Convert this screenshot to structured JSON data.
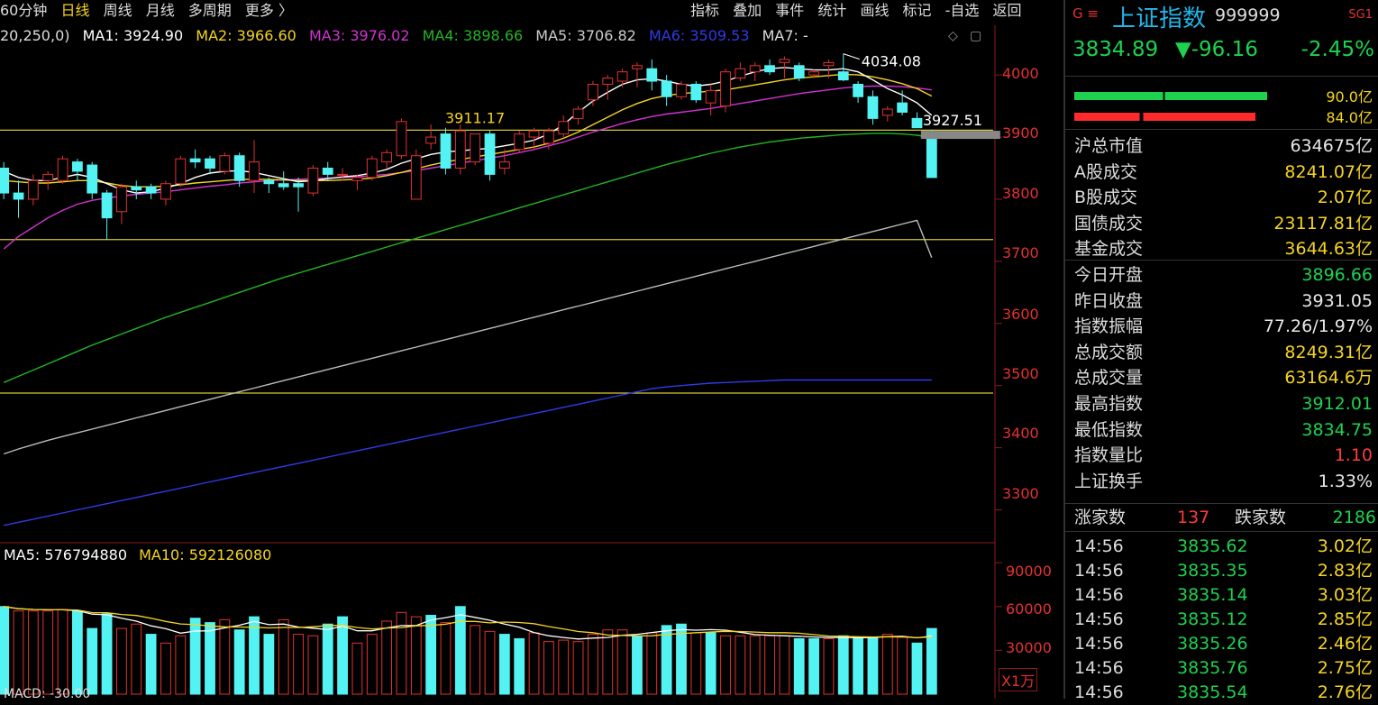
{
  "toolbar": {
    "left": [
      "60分钟",
      "日线",
      "周线",
      "月线",
      "多周期",
      "更多 〉"
    ],
    "right": [
      "指标",
      "叠加",
      "事件",
      "统计",
      "画线",
      "标记",
      "-自选",
      "返回"
    ]
  },
  "ma_legend": {
    "params": "20,250,0)",
    "ma1": "MA1: 3924.90",
    "ma2": "MA2: 3966.60",
    "ma3": "MA3: 3976.02",
    "ma4": "MA4: 3898.66",
    "ma5": "MA5: 3706.82",
    "ma6": "MA6: 3509.53",
    "ma7": "MA7: -"
  },
  "vol_legend": {
    "ma5": "MA5: 576794880",
    "ma10": "MA10: 592126080"
  },
  "bottom_legend": "MACD: -30.00",
  "annotations": {
    "high": "4034.08",
    "mid": "3927.51",
    "level": "3911.17"
  },
  "price_axis": [
    "4000",
    "3900",
    "3800",
    "3700",
    "3600",
    "3500",
    "3400",
    "3300"
  ],
  "volume_axis": [
    "90000",
    "60000",
    "30000"
  ],
  "volume_unit": "X1万",
  "colors": {
    "up": "#e23232",
    "down": "#54f3f3",
    "ma1": "#ffffff",
    "ma2": "#f5d422",
    "ma3": "#d233d2",
    "ma4": "#22b522",
    "ma5": "#bbbbbb",
    "ma6": "#2f3be8"
  },
  "chart_data": {
    "type": "candlestick",
    "price_ylim": [
      3250,
      4080
    ],
    "volume_ylim": [
      0,
      100000
    ],
    "horizontal_lines": [
      3911.17,
      3735,
      3488
    ],
    "candles": [
      [
        3850,
        3860,
        3800,
        3810
      ],
      [
        3810,
        3830,
        3770,
        3800
      ],
      [
        3800,
        3840,
        3790,
        3830
      ],
      [
        3830,
        3845,
        3815,
        3840
      ],
      [
        3830,
        3870,
        3825,
        3865
      ],
      [
        3860,
        3865,
        3830,
        3845
      ],
      [
        3855,
        3860,
        3800,
        3810
      ],
      [
        3810,
        3815,
        3735,
        3770
      ],
      [
        3780,
        3825,
        3760,
        3820
      ],
      [
        3820,
        3830,
        3800,
        3815
      ],
      [
        3820,
        3825,
        3800,
        3810
      ],
      [
        3800,
        3830,
        3790,
        3825
      ],
      [
        3825,
        3870,
        3820,
        3865
      ],
      [
        3865,
        3880,
        3850,
        3860
      ],
      [
        3865,
        3870,
        3840,
        3850
      ],
      [
        3845,
        3875,
        3840,
        3870
      ],
      [
        3870,
        3875,
        3820,
        3830
      ],
      [
        3830,
        3895,
        3810,
        3860
      ],
      [
        3830,
        3835,
        3810,
        3825
      ],
      [
        3825,
        3845,
        3815,
        3820
      ],
      [
        3825,
        3835,
        3780,
        3820
      ],
      [
        3810,
        3855,
        3805,
        3850
      ],
      [
        3850,
        3860,
        3830,
        3840
      ],
      [
        3840,
        3850,
        3830,
        3840
      ],
      [
        3830,
        3840,
        3815,
        3835
      ],
      [
        3835,
        3870,
        3830,
        3865
      ],
      [
        3860,
        3880,
        3850,
        3875
      ],
      [
        3870,
        3930,
        3865,
        3925
      ],
      [
        3800,
        3880,
        3800,
        3870
      ],
      [
        3890,
        3920,
        3880,
        3900
      ],
      [
        3905,
        3915,
        3840,
        3850
      ],
      [
        3850,
        3920,
        3840,
        3910
      ],
      [
        3860,
        3905,
        3855,
        3905
      ],
      [
        3905,
        3910,
        3830,
        3840
      ],
      [
        3850,
        3880,
        3840,
        3860
      ],
      [
        3880,
        3910,
        3875,
        3905
      ],
      [
        3900,
        3915,
        3880,
        3910
      ],
      [
        3890,
        3915,
        3880,
        3910
      ],
      [
        3905,
        3935,
        3900,
        3925
      ],
      [
        3930,
        3950,
        3920,
        3945
      ],
      [
        3960,
        3990,
        3950,
        3985
      ],
      [
        3985,
        4000,
        3960,
        3995
      ],
      [
        3990,
        4010,
        3980,
        4005
      ],
      [
        4010,
        4020,
        3980,
        4015
      ],
      [
        4010,
        4025,
        3975,
        3990
      ],
      [
        3990,
        4000,
        3950,
        3965
      ],
      [
        3965,
        3990,
        3960,
        3985
      ],
      [
        3985,
        3990,
        3955,
        3960
      ],
      [
        3955,
        3985,
        3935,
        3975
      ],
      [
        3950,
        4010,
        3940,
        4005
      ],
      [
        3995,
        4020,
        3990,
        4010
      ],
      [
        4005,
        4020,
        3990,
        4015
      ],
      [
        4015,
        4025,
        4000,
        4005
      ],
      [
        4020,
        4030,
        3995,
        4025
      ],
      [
        4015,
        4020,
        3990,
        3995
      ],
      [
        4000,
        4010,
        3995,
        4005
      ],
      [
        4015,
        4025,
        3995,
        4020
      ],
      [
        4005,
        4034,
        3990,
        3992
      ],
      [
        3985,
        3990,
        3955,
        3965
      ],
      [
        3965,
        3975,
        3920,
        3930
      ],
      [
        3935,
        3950,
        3925,
        3945
      ],
      [
        3955,
        3975,
        3935,
        3940
      ],
      [
        3930,
        3940,
        3915,
        3915
      ],
      [
        3896.66,
        3912.01,
        3834.75,
        3834.89
      ]
    ],
    "volume": [
      {
        "v": 60000,
        "up": false
      },
      {
        "v": 57000,
        "up": true
      },
      {
        "v": 57000,
        "up": true
      },
      {
        "v": 57000,
        "up": true
      },
      {
        "v": 58000,
        "up": true
      },
      {
        "v": 57000,
        "up": false
      },
      {
        "v": 45000,
        "up": false
      },
      {
        "v": 55000,
        "up": false
      },
      {
        "v": 45000,
        "up": true
      },
      {
        "v": 48000,
        "up": true
      },
      {
        "v": 41000,
        "up": false
      },
      {
        "v": 35000,
        "up": true
      },
      {
        "v": 40000,
        "up": true
      },
      {
        "v": 52000,
        "up": false
      },
      {
        "v": 49000,
        "up": false
      },
      {
        "v": 51000,
        "up": true
      },
      {
        "v": 44000,
        "up": false
      },
      {
        "v": 53000,
        "up": false
      },
      {
        "v": 41000,
        "up": false
      },
      {
        "v": 51000,
        "up": true
      },
      {
        "v": 41000,
        "up": true
      },
      {
        "v": 40000,
        "up": true
      },
      {
        "v": 48000,
        "up": false
      },
      {
        "v": 53000,
        "up": false
      },
      {
        "v": 35000,
        "up": true
      },
      {
        "v": 41000,
        "up": true
      },
      {
        "v": 50000,
        "up": true
      },
      {
        "v": 56000,
        "up": true
      },
      {
        "v": 53000,
        "up": true
      },
      {
        "v": 54000,
        "up": false
      },
      {
        "v": 49000,
        "up": true
      },
      {
        "v": 60000,
        "up": false
      },
      {
        "v": 47000,
        "up": true
      },
      {
        "v": 43000,
        "up": true
      },
      {
        "v": 41000,
        "up": false
      },
      {
        "v": 38000,
        "up": false
      },
      {
        "v": 42000,
        "up": true
      },
      {
        "v": 36000,
        "up": true
      },
      {
        "v": 37000,
        "up": true
      },
      {
        "v": 36000,
        "up": true
      },
      {
        "v": 41000,
        "up": true
      },
      {
        "v": 44000,
        "up": true
      },
      {
        "v": 44000,
        "up": true
      },
      {
        "v": 40000,
        "up": false
      },
      {
        "v": 42000,
        "up": true
      },
      {
        "v": 47000,
        "up": false
      },
      {
        "v": 48000,
        "up": false
      },
      {
        "v": 42000,
        "up": true
      },
      {
        "v": 42000,
        "up": false
      },
      {
        "v": 40000,
        "up": true
      },
      {
        "v": 40000,
        "up": true
      },
      {
        "v": 40000,
        "up": true
      },
      {
        "v": 40000,
        "up": true
      },
      {
        "v": 40000,
        "up": true
      },
      {
        "v": 38000,
        "up": false
      },
      {
        "v": 38000,
        "up": false
      },
      {
        "v": 38000,
        "up": true
      },
      {
        "v": 40000,
        "up": false
      },
      {
        "v": 39000,
        "up": false
      },
      {
        "v": 39000,
        "up": false
      },
      {
        "v": 41000,
        "up": true
      },
      {
        "v": 39000,
        "up": true
      },
      {
        "v": 35000,
        "up": false
      },
      {
        "v": 45000,
        "up": false
      }
    ],
    "ma_lines": {
      "ma1": [
        3845,
        3835,
        3830,
        3830,
        3835,
        3840,
        3835,
        3825,
        3815,
        3810,
        3812,
        3818,
        3825,
        3835,
        3842,
        3845,
        3846,
        3843,
        3838,
        3833,
        3828,
        3830,
        3833,
        3836,
        3838,
        3842,
        3848,
        3858,
        3865,
        3872,
        3876,
        3878,
        3880,
        3882,
        3886,
        3890,
        3895,
        3905,
        3920,
        3940,
        3958,
        3972,
        3985,
        3992,
        3994,
        3990,
        3985,
        3982,
        3985,
        3990,
        3998,
        4005,
        4010,
        4012,
        4010,
        4008,
        4008,
        4010,
        4005,
        3992,
        3978,
        3968,
        3955,
        3935
      ],
      "ma2": [
        3830,
        3828,
        3826,
        3826,
        3828,
        3830,
        3830,
        3826,
        3822,
        3820,
        3820,
        3821,
        3823,
        3826,
        3828,
        3830,
        3832,
        3832,
        3832,
        3831,
        3830,
        3830,
        3830,
        3831,
        3832,
        3834,
        3838,
        3843,
        3849,
        3855,
        3860,
        3864,
        3868,
        3872,
        3876,
        3880,
        3884,
        3890,
        3898,
        3908,
        3920,
        3932,
        3944,
        3954,
        3962,
        3967,
        3970,
        3972,
        3974,
        3976,
        3980,
        3984,
        3988,
        3992,
        3995,
        3997,
        3999,
        4001,
        4000,
        3997,
        3992,
        3986,
        3978,
        3966
      ],
      "ma3": [
        3720,
        3740,
        3755,
        3770,
        3782,
        3792,
        3798,
        3802,
        3805,
        3808,
        3810,
        3812,
        3815,
        3818,
        3821,
        3823,
        3826,
        3828,
        3830,
        3831,
        3832,
        3833,
        3834,
        3835,
        3836,
        3838,
        3840,
        3843,
        3846,
        3850,
        3854,
        3858,
        3862,
        3866,
        3870,
        3875,
        3880,
        3886,
        3892,
        3900,
        3908,
        3915,
        3922,
        3928,
        3933,
        3937,
        3940,
        3943,
        3946,
        3950,
        3954,
        3958,
        3962,
        3966,
        3970,
        3973,
        3976,
        3979,
        3981,
        3982,
        3982,
        3981,
        3979,
        3976
      ],
      "ma4": [
        3505,
        3515,
        3525,
        3535,
        3545,
        3555,
        3565,
        3574,
        3583,
        3592,
        3601,
        3610,
        3618,
        3626,
        3634,
        3642,
        3650,
        3658,
        3666,
        3674,
        3681,
        3688,
        3695,
        3702,
        3709,
        3716,
        3723,
        3730,
        3737,
        3744,
        3751,
        3758,
        3765,
        3772,
        3779,
        3786,
        3793,
        3800,
        3807,
        3814,
        3821,
        3828,
        3835,
        3842,
        3849,
        3856,
        3862,
        3868,
        3874,
        3879,
        3884,
        3888,
        3892,
        3895,
        3898,
        3900,
        3902,
        3904,
        3905,
        3906,
        3906,
        3905,
        3903,
        3899
      ],
      "ma5": [
        3390,
        3398,
        3405,
        3412,
        3418,
        3424,
        3430,
        3436,
        3442,
        3448,
        3454,
        3460,
        3466,
        3472,
        3478,
        3484,
        3490,
        3496,
        3502,
        3508,
        3514,
        3520,
        3526,
        3532,
        3538,
        3544,
        3550,
        3556,
        3562,
        3568,
        3574,
        3580,
        3586,
        3592,
        3598,
        3604,
        3610,
        3616,
        3622,
        3628,
        3634,
        3640,
        3646,
        3652,
        3658,
        3664,
        3670,
        3676,
        3682,
        3688,
        3694,
        3700,
        3706,
        3712,
        3718,
        3724,
        3730,
        3736,
        3742,
        3748,
        3754,
        3760,
        3766,
        3706
      ],
      "ma6": [
        3275,
        3280,
        3285,
        3290,
        3295,
        3300,
        3305,
        3310,
        3315,
        3320,
        3325,
        3330,
        3335,
        3340,
        3345,
        3350,
        3355,
        3360,
        3365,
        3370,
        3375,
        3380,
        3385,
        3390,
        3395,
        3400,
        3405,
        3410,
        3415,
        3420,
        3425,
        3430,
        3435,
        3440,
        3445,
        3450,
        3455,
        3460,
        3465,
        3470,
        3475,
        3480,
        3485,
        3490,
        3495,
        3498,
        3500,
        3502,
        3504,
        3505,
        3506,
        3507,
        3508,
        3509,
        3509,
        3509,
        3509,
        3509,
        3509,
        3509,
        3509,
        3509,
        3509,
        3509
      ]
    }
  },
  "quote": {
    "marks": "G ≡",
    "name": "上证指数",
    "code": "999999",
    "tag": "SG1",
    "price": "3834.89",
    "change": "▼-96.16",
    "pct": "-2.45%",
    "buy_amount": "90.0亿",
    "sell_amount": "84.0亿",
    "buy_fill": 0.63,
    "sell_fill": 0.59
  },
  "stats": [
    {
      "k": "沪总市值",
      "v": "634675亿",
      "c": "w"
    },
    {
      "k": "A股成交",
      "v": "8241.07亿",
      "c": "y"
    },
    {
      "k": "B股成交",
      "v": "2.07亿",
      "c": "y"
    },
    {
      "k": "国债成交",
      "v": "23117.81亿",
      "c": "y"
    },
    {
      "k": "基金成交",
      "v": "3644.63亿",
      "c": "y"
    },
    {
      "k": "今日开盘",
      "v": "3896.66",
      "c": "g"
    },
    {
      "k": "昨日收盘",
      "v": "3931.05",
      "c": "w"
    },
    {
      "k": "指数振幅",
      "v": "77.26/1.97%",
      "c": "w"
    },
    {
      "k": "总成交额",
      "v": "8249.31亿",
      "c": "y"
    },
    {
      "k": "总成交量",
      "v": "63164.6万",
      "c": "y"
    },
    {
      "k": "最高指数",
      "v": "3912.01",
      "c": "g"
    },
    {
      "k": "最低指数",
      "v": "3834.75",
      "c": "g"
    },
    {
      "k": "指数量比",
      "v": "1.10",
      "c": "r"
    },
    {
      "k": "上证换手",
      "v": "1.33%",
      "c": "w"
    }
  ],
  "breadth": {
    "up_label": "涨家数",
    "up": "137",
    "down_label": "跌家数",
    "down": "2186"
  },
  "ticks": [
    {
      "t": "14:56",
      "p": "3835.62",
      "a": "3.02亿"
    },
    {
      "t": "14:56",
      "p": "3835.35",
      "a": "2.83亿"
    },
    {
      "t": "14:56",
      "p": "3835.14",
      "a": "3.03亿"
    },
    {
      "t": "14:56",
      "p": "3835.12",
      "a": "2.85亿"
    },
    {
      "t": "14:56",
      "p": "3835.26",
      "a": "2.46亿"
    },
    {
      "t": "14:56",
      "p": "3835.76",
      "a": "2.75亿"
    },
    {
      "t": "14:56",
      "p": "3835.54",
      "a": "2.76亿"
    }
  ]
}
